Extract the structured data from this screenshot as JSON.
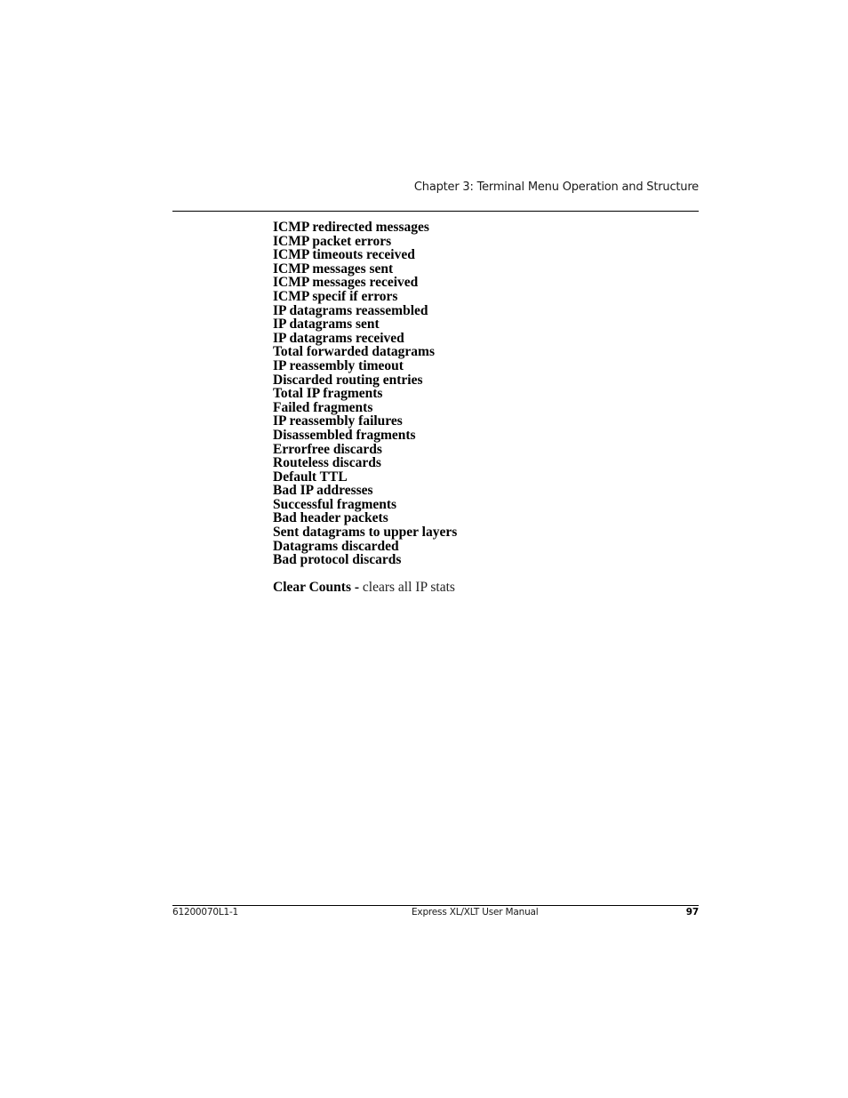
{
  "header": {
    "chapter_title": "Chapter 3: Terminal Menu Operation and Structure"
  },
  "stats": [
    "ICMP redirected messages",
    "ICMP packet errors",
    "ICMP timeouts received",
    "ICMP messages sent",
    "ICMP messages received",
    "ICMP specif if errors",
    "IP datagrams reassembled",
    "IP datagrams sent",
    "IP datagrams received",
    "Total forwarded datagrams",
    "IP reassembly timeout",
    "Discarded routing entries",
    "Total IP fragments",
    "Failed fragments",
    "IP reassembly failures",
    "Disassembled fragments",
    "Errorfree discards",
    "Routeless discards",
    "Default TTL",
    "Bad IP addresses",
    "Successful fragments",
    "Bad header packets",
    "Sent datagrams to upper layers",
    "Datagrams discarded",
    "Bad protocol discards"
  ],
  "clear_counts": {
    "label": "Clear Counts - ",
    "description": "clears all IP stats"
  },
  "footer": {
    "doc_number": "61200070L1-1",
    "manual_title": "Express XL/XLT User Manual",
    "page_number": "97"
  }
}
